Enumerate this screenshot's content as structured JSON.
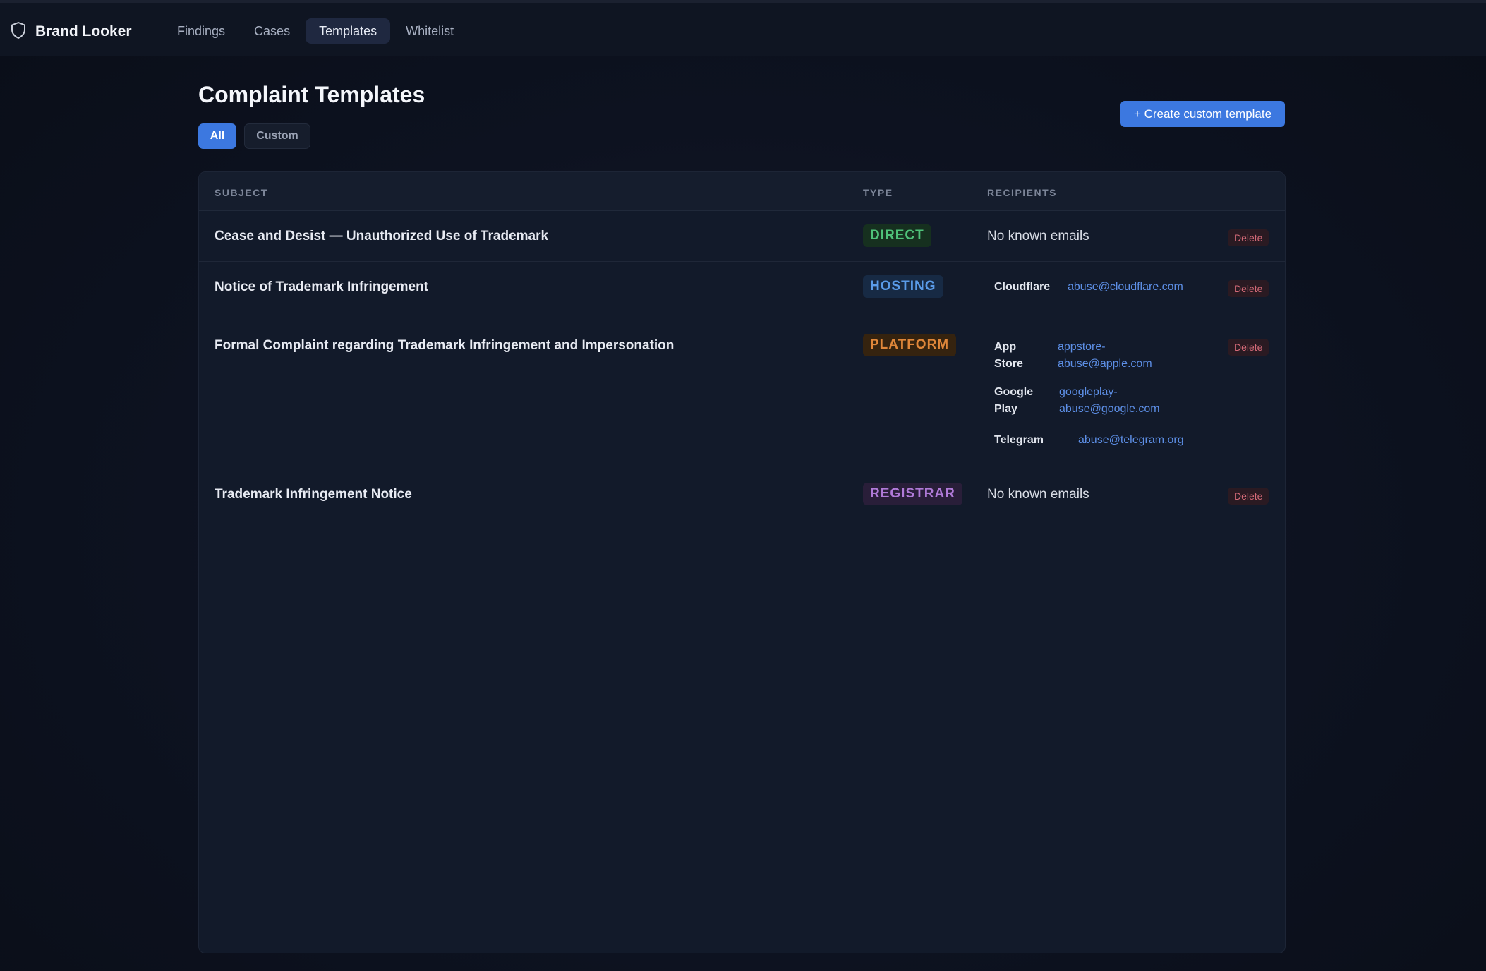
{
  "header": {
    "brand": "Brand Looker",
    "nav": [
      {
        "label": "Findings",
        "active": false
      },
      {
        "label": "Cases",
        "active": false
      },
      {
        "label": "Templates",
        "active": true
      },
      {
        "label": "Whitelist",
        "active": false
      }
    ]
  },
  "page": {
    "title": "Complaint Templates",
    "filters": [
      {
        "label": "All",
        "selected": true
      },
      {
        "label": "Custom",
        "selected": false
      }
    ],
    "create_button": "+ Create custom template"
  },
  "table": {
    "columns": [
      "SUBJECT",
      "TYPE",
      "RECIPIENTS"
    ],
    "rows": [
      {
        "subject": "Cease and Desist — Unauthorized Use of Trademark",
        "type": "DIRECT",
        "recipients_text": "No known emails",
        "delete": "Delete"
      },
      {
        "subject": "Notice of Trademark Infringement",
        "type": "HOSTING",
        "recipients": [
          {
            "name": "Cloudflare",
            "email": "abuse@cloudflare.com"
          }
        ],
        "delete": "Delete"
      },
      {
        "subject": "Formal Complaint regarding Trademark Infringement and Impersonation",
        "type": "PLATFORM",
        "recipients": [
          {
            "name": "App Store",
            "email": "appstore-abuse@apple.com"
          },
          {
            "name": "Google Play",
            "email": "googleplay-abuse@google.com"
          },
          {
            "name": "Telegram",
            "email": "abuse@telegram.org"
          }
        ],
        "delete": "Delete"
      },
      {
        "subject": "Trademark Infringement Notice",
        "type": "REGISTRAR",
        "recipients_text": "No known emails",
        "delete": "Delete"
      }
    ]
  },
  "colors": {
    "accent": "#3c78e0",
    "direct": "#4fc27a",
    "hosting": "#5a9be8",
    "platform": "#e0873a",
    "registrar": "#b07ad8",
    "delete": "#d46a78"
  }
}
